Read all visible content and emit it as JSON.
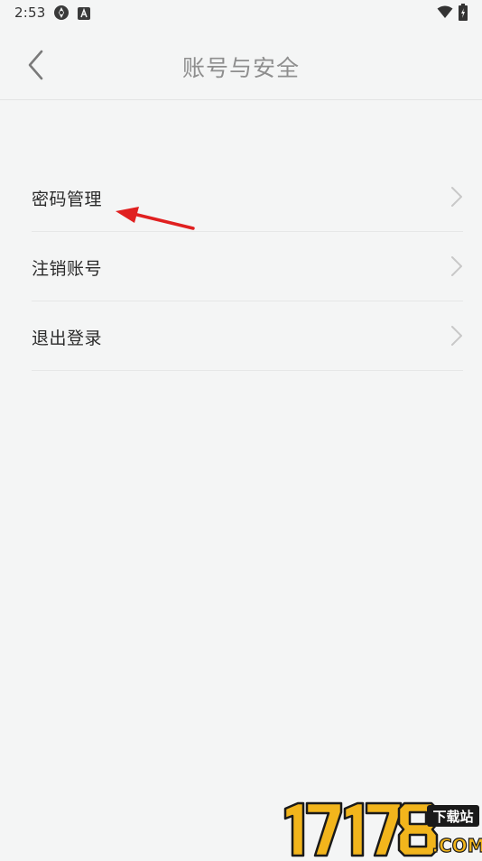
{
  "status_bar": {
    "time": "2:53",
    "icons": [
      "vpn-icon",
      "accessibility-a-icon",
      "wifi-icon",
      "battery-charging-icon"
    ]
  },
  "app_bar": {
    "title": "账号与安全",
    "back_icon": "chevron-left-icon"
  },
  "menu": {
    "items": [
      {
        "label": "密码管理",
        "icon": "chevron-right-icon"
      },
      {
        "label": "注销账号",
        "icon": "chevron-right-icon"
      },
      {
        "label": "退出登录",
        "icon": "chevron-right-icon"
      }
    ]
  },
  "annotation": {
    "icon": "red-arrow-icon",
    "color": "#e02020"
  },
  "watermark": {
    "logo": "17178-logo",
    "site_name": "下载站",
    "number": "17178",
    "domain": ".COM",
    "colors": {
      "primary": "#f2b51c",
      "dark": "#1a1a1a"
    }
  }
}
